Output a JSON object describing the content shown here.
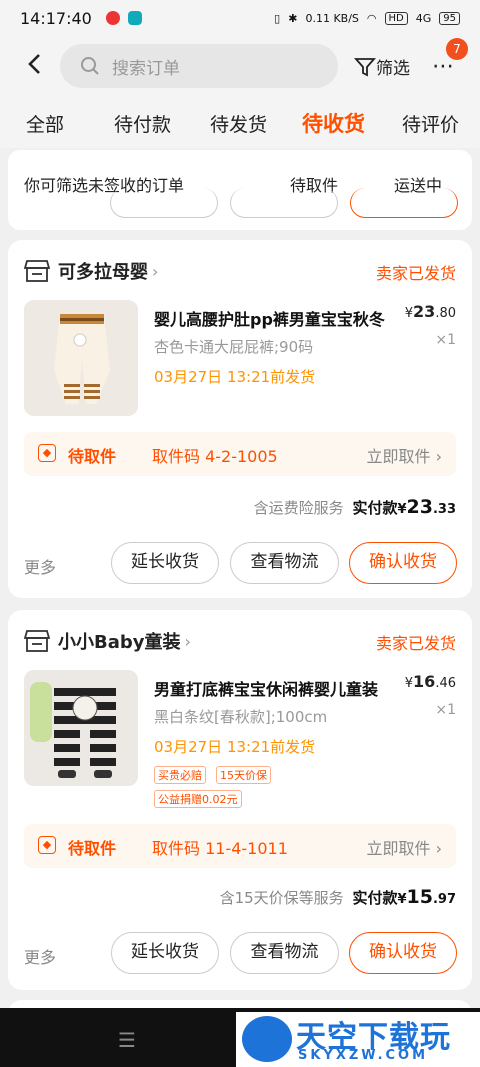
{
  "status_bar": {
    "time": "14:17:40",
    "net_speed": "0.11 KB/S",
    "hd": "HD",
    "signal": "4G",
    "battery": "95"
  },
  "header": {
    "search_placeholder": "搜索订单",
    "filter_label": "筛选",
    "more_icon": "⋯",
    "more_badge": "7"
  },
  "tabs": [
    {
      "label": "全部",
      "active": false
    },
    {
      "label": "待付款",
      "active": false
    },
    {
      "label": "待发货",
      "active": false
    },
    {
      "label": "待收货",
      "active": true
    },
    {
      "label": "待评价",
      "active": false
    }
  ],
  "filter_panel": {
    "text": "你可筛选未签收的订单",
    "options": [
      "待取件",
      "运送中"
    ]
  },
  "orders": [
    {
      "shop": "可多拉母婴",
      "status": "卖家已发货",
      "title": "婴儿高腰护肚pp裤男童宝宝秋冬",
      "variant": "杏色卡通大屁屁裤;90码",
      "deadline": "03月27日 13:21前发货",
      "price_symbol": "¥",
      "price_int": "23",
      "price_dec": ".80",
      "qty": "×1",
      "pickup_label": "待取件",
      "pickup_code": "取件码 4-2-1005",
      "pickup_action": "立即取件",
      "service_text": "含运费险服务",
      "total_label": "实付款",
      "total_symbol": "¥",
      "total_int": "23",
      "total_dec": ".33",
      "more": "更多",
      "buttons": [
        "延长收货",
        "查看物流",
        "确认收货"
      ]
    },
    {
      "shop": "小小Baby童装",
      "status": "卖家已发货",
      "title": "男童打底裤宝宝休闲裤婴儿童装",
      "variant": "黑白条纹[春秋款];100cm",
      "deadline": "03月27日 13:21前发货",
      "tags": [
        "买贵必赔",
        "15天价保",
        "公益捐赠0.02元"
      ],
      "price_symbol": "¥",
      "price_int": "16",
      "price_dec": ".46",
      "qty": "×1",
      "pickup_label": "待取件",
      "pickup_code": "取件码 11-4-1011",
      "pickup_action": "立即取件",
      "service_text": "含15天价保等服务",
      "total_label": "实付款",
      "total_symbol": "¥",
      "total_int": "15",
      "total_dec": ".97",
      "more": "更多",
      "buttons": [
        "延长收货",
        "查看物流",
        "确认收货"
      ]
    }
  ],
  "watermark": {
    "title": "天空下载玩",
    "sub": "SKYXZW.COM"
  },
  "colors": {
    "accent": "#ff5000",
    "deadline": "#ff9300",
    "background": "#f0f0f0"
  }
}
